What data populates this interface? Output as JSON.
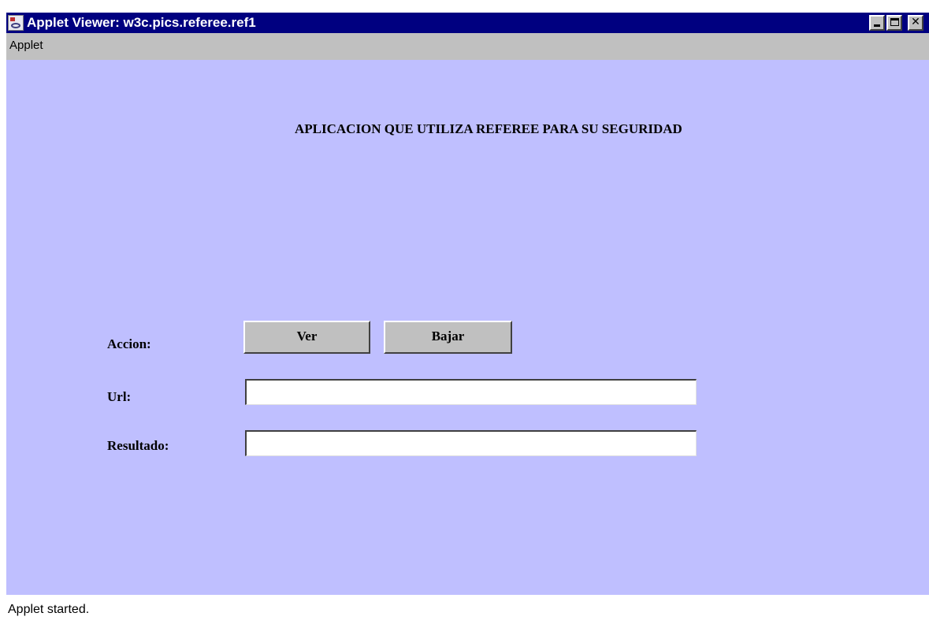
{
  "window": {
    "title": "Applet Viewer: w3c.pics.referee.ref1",
    "controls": [
      "minimize-icon",
      "maximize-icon",
      "close-icon"
    ]
  },
  "menubar": {
    "items": [
      {
        "label": "Applet"
      }
    ]
  },
  "applet": {
    "heading": "APLICACION QUE UTILIZA REFEREE PARA SU SEGURIDAD",
    "accion_label": "Accion:",
    "buttons": {
      "ver": "Ver",
      "bajar": "Bajar"
    },
    "url_label": "Url:",
    "url_value": "",
    "resultado_label": "Resultado:",
    "resultado_value": "",
    "background_color": "#bfbfff"
  },
  "status": {
    "text": "Applet started."
  },
  "colors": {
    "titlebar": "#000080",
    "chrome": "#c0c0c0"
  }
}
